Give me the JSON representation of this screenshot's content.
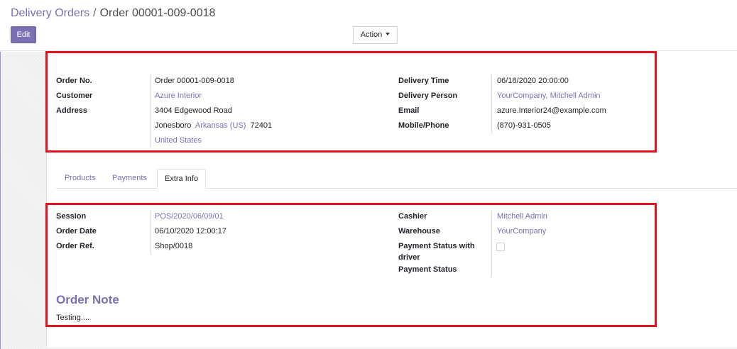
{
  "breadcrumb": {
    "parent": "Delivery Orders",
    "separator": "/",
    "current": "Order 00001-009-0018"
  },
  "buttons": {
    "edit": "Edit",
    "action": "Action"
  },
  "header_fields": {
    "order_no_label": "Order No.",
    "order_no": "Order 00001-009-0018",
    "customer_label": "Customer",
    "customer": "Azure Interior",
    "address_label": "Address",
    "street": "3404 Edgewood Road",
    "city": "Jonesboro",
    "state": "Arkansas (US)",
    "zip": "72401",
    "country": "United States",
    "delivery_time_label": "Delivery Time",
    "delivery_time": "06/18/2020 20:00:00",
    "delivery_person_label": "Delivery Person",
    "delivery_person": "YourCompany, Mitchell Admin",
    "email_label": "Email",
    "email": "azure.Interior24@example.com",
    "phone_label": "Mobile/Phone",
    "phone": "(870)-931-0505"
  },
  "tabs": [
    {
      "label": "Products",
      "active": false
    },
    {
      "label": "Payments",
      "active": false
    },
    {
      "label": "Extra Info",
      "active": true
    }
  ],
  "extra_info": {
    "session_label": "Session",
    "session": "POS/2020/06/09/01",
    "order_date_label": "Order Date",
    "order_date": "06/10/2020 12:00:17",
    "order_ref_label": "Order Ref.",
    "order_ref": "Shop/0018",
    "cashier_label": "Cashier",
    "cashier": "Mitchell Admin",
    "warehouse_label": "Warehouse",
    "warehouse": "YourCompany",
    "payment_status_driver_label_1": "Payment Status with",
    "payment_status_driver_label_2": "driver",
    "payment_status_driver_checked": false,
    "payment_status_label": "Payment Status"
  },
  "order_note": {
    "title": "Order Note",
    "text": "Testing...."
  },
  "colors": {
    "accent": "#7c6fb3",
    "highlight": "#e0141e"
  }
}
